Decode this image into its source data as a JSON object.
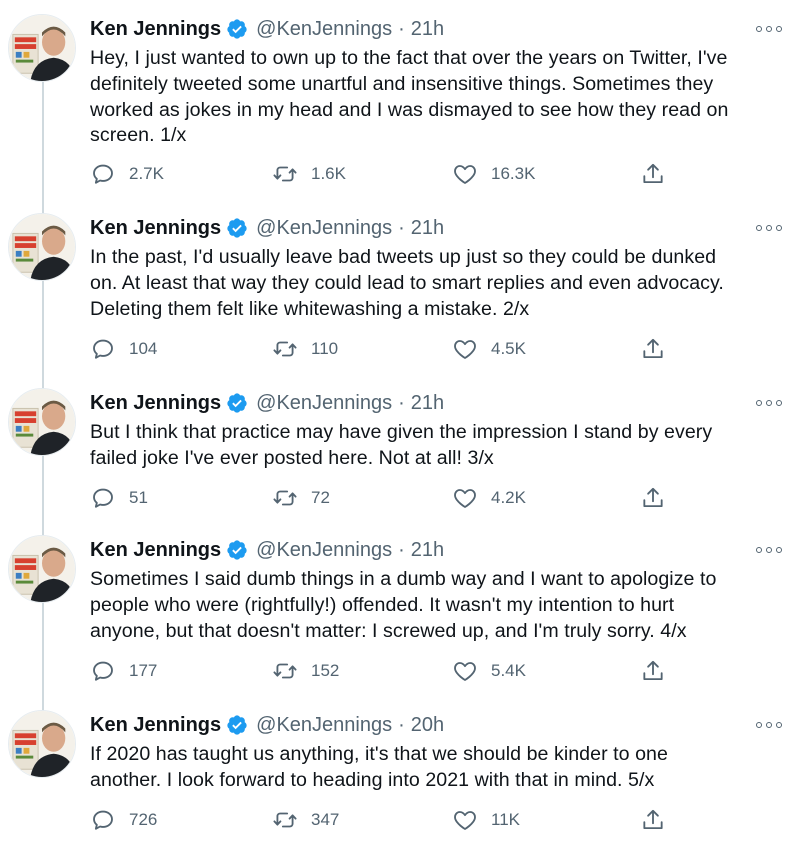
{
  "thread": {
    "tweets": [
      {
        "name": "Ken Jennings",
        "handle": "@KenJennings",
        "separator": "·",
        "time": "21h",
        "lines": [
          "Hey, I just wanted to own up to the fact that over the years on Twitter, I've",
          "definitely tweeted some unartful and insensitive things. Sometimes they",
          "worked as jokes in my head and I was dismayed to see how they read on",
          "screen. 1/x"
        ],
        "replies": "2.7K",
        "retweets": "1.6K",
        "likes": "16.3K"
      },
      {
        "name": "Ken Jennings",
        "handle": "@KenJennings",
        "separator": "·",
        "time": "21h",
        "lines": [
          "In the past, I'd usually leave bad tweets up just so they could be dunked",
          "on. At least that way they could lead to smart replies and even advocacy.",
          "Deleting them felt like whitewashing a mistake. 2/x"
        ],
        "replies": "104",
        "retweets": "110",
        "likes": "4.5K"
      },
      {
        "name": "Ken Jennings",
        "handle": "@KenJennings",
        "separator": "·",
        "time": "21h",
        "lines": [
          "But I think that practice may have given the impression I stand by every",
          "failed joke I've ever posted here. Not at all!  3/x"
        ],
        "replies": "51",
        "retweets": "72",
        "likes": "4.2K"
      },
      {
        "name": "Ken Jennings",
        "handle": "@KenJennings",
        "separator": "·",
        "time": "21h",
        "lines": [
          "Sometimes I said dumb things in a dumb way and I want to apologize to",
          "people who were (rightfully!) offended.  It wasn't my intention to hurt",
          "anyone, but that doesn't matter: I screwed up, and I'm truly sorry.  4/x"
        ],
        "replies": "177",
        "retweets": "152",
        "likes": "5.4K"
      },
      {
        "name": "Ken Jennings",
        "handle": "@KenJennings",
        "separator": "·",
        "time": "20h",
        "lines": [
          "If 2020 has taught us anything, it's that we should be kinder to one",
          "another.  I look forward to heading into 2021 with that in mind. 5/x"
        ],
        "replies": "726",
        "retweets": "347",
        "likes": "11K"
      }
    ]
  },
  "icons": {
    "verified": "verified-badge-icon",
    "more": "more-options-icon",
    "reply": "reply-icon",
    "retweet": "retweet-icon",
    "like": "heart-icon",
    "share": "share-icon"
  },
  "colors": {
    "text": "#0f1419",
    "secondary": "#536471",
    "verified": "#1d9bf0",
    "thread_line": "#cfd9de"
  }
}
